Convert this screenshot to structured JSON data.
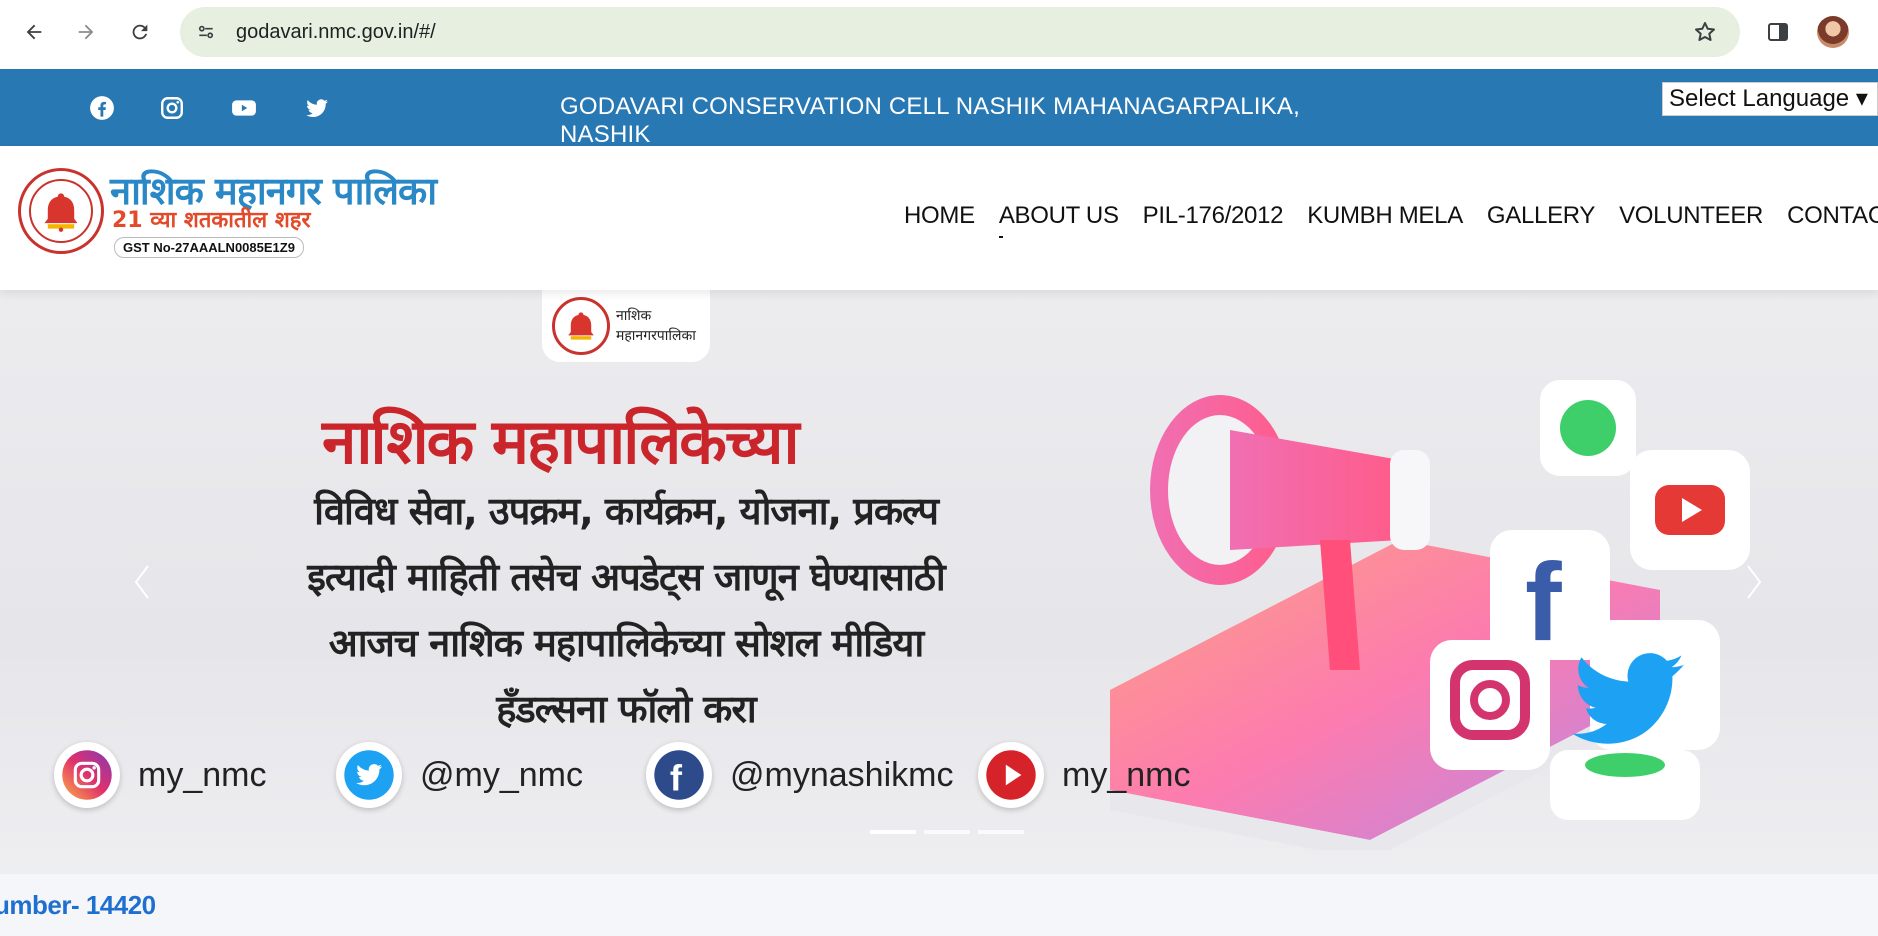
{
  "browser": {
    "url": "godavari.nmc.gov.in/#/"
  },
  "topbar": {
    "title": "GODAVARI CONSERVATION CELL NASHIK MAHANAGARPALIKA, NASHIK",
    "social_icons": [
      "facebook-icon",
      "instagram-icon",
      "youtube-icon",
      "twitter-icon"
    ],
    "language_select": "Select Language",
    "bg_color": "#2878b4"
  },
  "header": {
    "logo_title": "नाशिक महानगर पालिका",
    "logo_subtitle": "21 व्या शतकातील शहर",
    "gst": "GST No-27AAALN0085E1Z9",
    "menu": [
      {
        "label": "HOME"
      },
      {
        "label": "ABOUT US"
      },
      {
        "label": "PIL-176/2012"
      },
      {
        "label": "KUMBH MELA"
      },
      {
        "label": "GALLERY"
      },
      {
        "label": "VOLUNTEER"
      },
      {
        "label": "CONTACT"
      }
    ]
  },
  "hero": {
    "logo_text_1": "नाशिक",
    "logo_text_2": "महानगरपालिका",
    "heading": "नाशिक महापालिकेच्या",
    "lines": [
      "विविध सेवा, उपक्रम, कार्यक्रम, योजना, प्रकल्प",
      "इत्यादी माहिती तसेच अपडेट्स जाणून घेण्यासाठी",
      "आजच नाशिक महापालिकेच्या सोशल मीडिया",
      "हँडल्सना फॉलो करा"
    ],
    "handles": [
      {
        "icon": "instagram-icon",
        "label": "my_nmc"
      },
      {
        "icon": "twitter-icon",
        "label": "@my_nmc"
      },
      {
        "icon": "facebook-icon",
        "label": "@mynashikmc"
      },
      {
        "icon": "youtube-icon",
        "label": "my_nmc"
      }
    ],
    "slides": 3,
    "active_slide": 1
  },
  "ticker": {
    "text": "umber- 14420"
  }
}
